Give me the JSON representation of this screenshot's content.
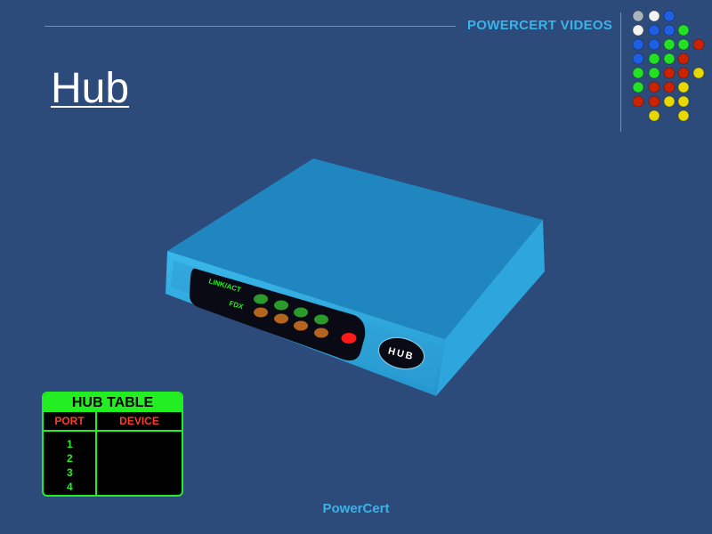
{
  "header": {
    "brand": "POWERCERT VIDEOS",
    "dot_colors": {
      "white": "#f2f2f2",
      "blue": "#1f5fe6",
      "green": "#22e022",
      "red": "#cc2200",
      "yellow": "#e6d800",
      "gray": "#a9b3bd"
    }
  },
  "slide": {
    "title": "Hub"
  },
  "device": {
    "label_link": "LINK/ACT",
    "label_fdx": "FDX",
    "badge": "HUB",
    "colors": {
      "body": "#2ea0d6",
      "top": "#1f86bf",
      "panel": "#0a0a14",
      "led_green": "#2a9a2a",
      "led_orange": "#b3641e",
      "led_red": "#ff1a1a"
    }
  },
  "hub_table": {
    "title": "HUB TABLE",
    "col_port": "PORT",
    "col_device": "DEVICE",
    "ports": [
      "1",
      "2",
      "3",
      "4"
    ],
    "colors": {
      "border": "#22ee22",
      "header_text": "#ff3b2e"
    }
  },
  "footer": {
    "text": "PowerCert"
  }
}
